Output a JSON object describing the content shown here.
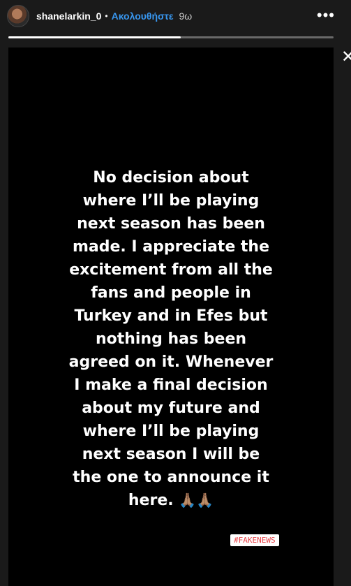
{
  "header": {
    "username": "shanelarkin_0",
    "separator": "•",
    "follow_label": "Ακολουθήστε",
    "timestamp": "9ω",
    "more_label": "•••"
  },
  "progress": {
    "fraction": 0.53
  },
  "close_label": "✕",
  "story": {
    "text": "No decision about\nwhere I’ll be playing\nnext season has been\nmade. I appreciate the\nexcitement from all the\nfans and people in\nTurkey and in Efes but\nnothing has been\nagreed on it. Whenever\nI make a final decision\nabout my future and\nwhere I’ll be playing\nnext season I will be\nthe one to announce it\nhere.",
    "emoji": "🙏🏽🙏🏽",
    "hashtag": "#FAKENEWS"
  },
  "colors": {
    "follow": "#3897f0",
    "background": "#000000",
    "hashtag_text": "#e8464b"
  }
}
